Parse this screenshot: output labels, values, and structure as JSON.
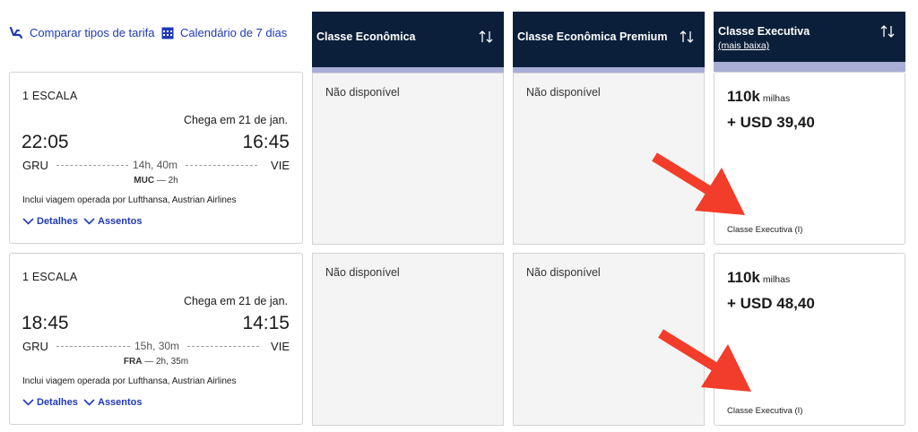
{
  "toolbar": {
    "compare_label": "Comparar tipos de tarifa",
    "calendar_label": "Calendário de 7 dias"
  },
  "columns": [
    {
      "title": "Classe Econômica"
    },
    {
      "title": "Classe Econômica Premium"
    },
    {
      "title": "Classe Executiva",
      "subtitle": "(mais baixa)"
    }
  ],
  "colors": {
    "header_bg": "#0b1f3a",
    "band": "#a8aed6",
    "link": "#1f3ab5",
    "arrow": "#f23d2a"
  },
  "flights": [
    {
      "stops": "1 ESCALA",
      "arrival_note": "Chega em 21 de jan.",
      "depart_time": "22:05",
      "arrive_time": "16:45",
      "origin": "GRU",
      "destination": "VIE",
      "duration": "14h, 40m",
      "layover_airport": "MUC",
      "layover_time": " — 2h",
      "operated_by": "Inclui viagem operada por Lufthansa, Austrian Airlines",
      "details_label": "Detalhes",
      "seats_label": "Assentos",
      "economy": "Não disponível",
      "premium": "Não disponível",
      "business": {
        "miles": "110k",
        "miles_unit": "milhas",
        "usd": "+ USD 39,40",
        "class": "Classe Executiva (I)"
      }
    },
    {
      "stops": "1 ESCALA",
      "arrival_note": "Chega em 21 de jan.",
      "depart_time": "18:45",
      "arrive_time": "14:15",
      "origin": "GRU",
      "destination": "VIE",
      "duration": "15h, 30m",
      "layover_airport": "FRA",
      "layover_time": " — 2h, 35m",
      "operated_by": "Inclui viagem operada por Lufthansa, Austrian Airlines",
      "details_label": "Detalhes",
      "seats_label": "Assentos",
      "economy": "Não disponível",
      "premium": "Não disponível",
      "business": {
        "miles": "110k",
        "miles_unit": "milhas",
        "usd": "+ USD 48,40",
        "class": "Classe Executiva (I)"
      }
    }
  ]
}
